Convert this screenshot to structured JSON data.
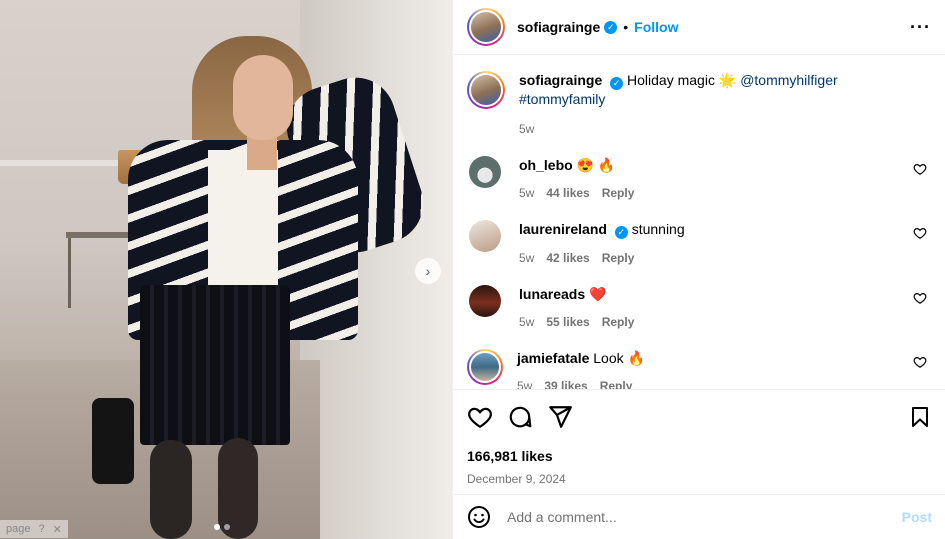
{
  "post": {
    "username": "sofiagrainge",
    "follow_label": "Follow",
    "separator": "•",
    "caption": {
      "username": "sofiagrainge",
      "text": "Holiday magic",
      "emoji": "🌟",
      "mention": "@tommyhilfiger",
      "hashtag": "#tommyfamily",
      "age": "5w"
    },
    "likes": "166,981 likes",
    "date": "December 9, 2024"
  },
  "comments": [
    {
      "username": "oh_lebo",
      "text": "",
      "emoji": "😍 🔥",
      "age": "5w",
      "likes": "44 likes",
      "reply": "Reply",
      "avatar_color": "#5c6f6a"
    },
    {
      "username": "laurenireland",
      "verified": true,
      "text": "stunning",
      "emoji": "",
      "age": "5w",
      "likes": "42 likes",
      "reply": "Reply",
      "avatar_color": "#d8c6b8"
    },
    {
      "username": "lunareads",
      "text": "",
      "emoji": "❤️",
      "age": "5w",
      "likes": "55 likes",
      "reply": "Reply",
      "avatar_color": "#5a2a1f"
    },
    {
      "username": "jamiefatale",
      "text": "Look",
      "emoji": "🔥",
      "age": "5w",
      "likes": "39 likes",
      "reply": "Reply",
      "avatar_color": "#3e6a88"
    }
  ],
  "composer": {
    "placeholder": "Add a comment...",
    "post_label": "Post"
  },
  "overlay_hint": "page",
  "icons": [
    "more-icon",
    "heart-icon",
    "comment-icon",
    "share-icon",
    "save-icon",
    "emoji-icon",
    "verified-icon",
    "chevron-right-icon"
  ],
  "colors": {
    "link": "#00376b",
    "follow": "#0095f6",
    "muted": "#737373"
  }
}
